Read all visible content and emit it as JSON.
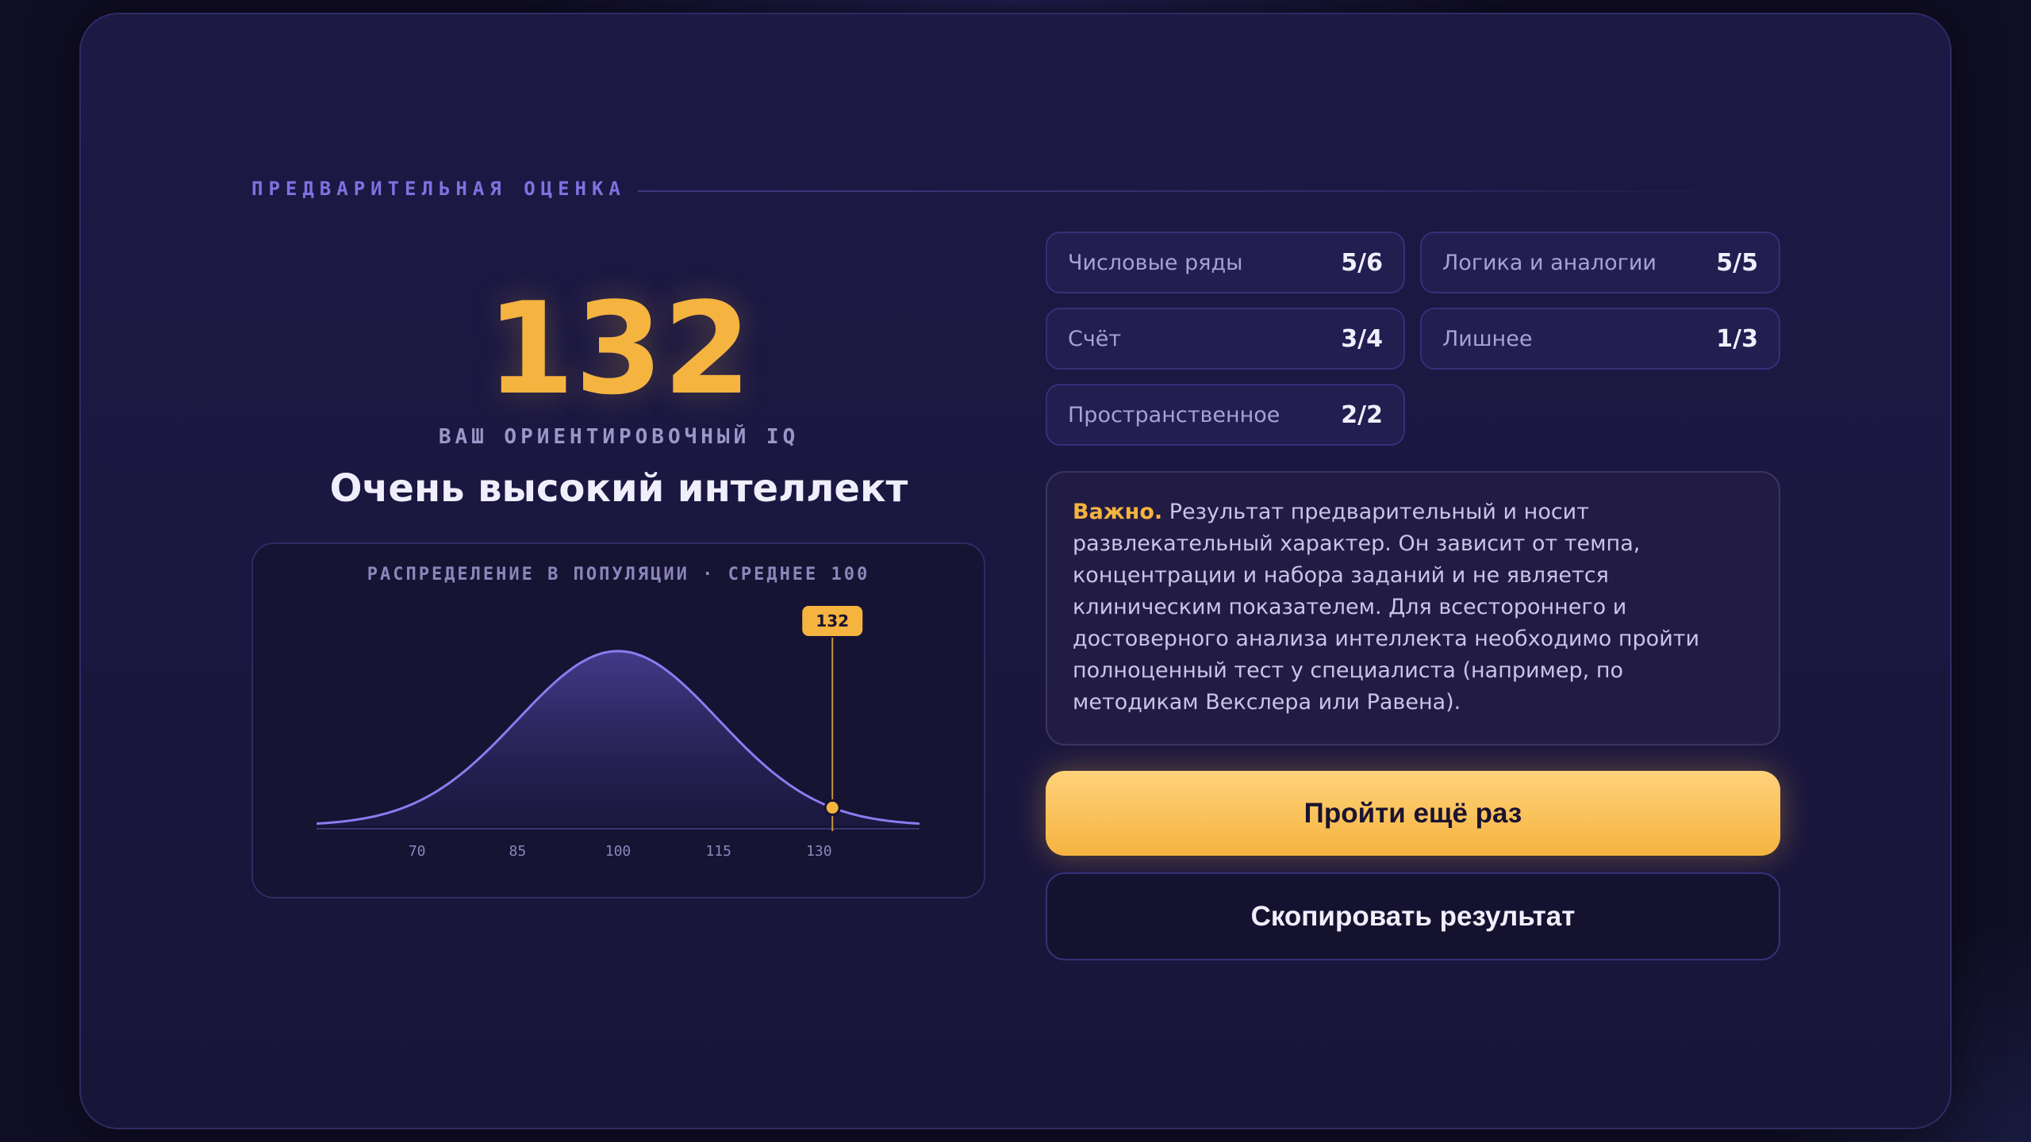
{
  "eyebrow": "ПРЕДВАРИТЕЛЬНАЯ ОЦЕНКА",
  "score": {
    "value": "132",
    "label": "ВАШ ОРИЕНТИРОВОЧНЫЙ IQ",
    "verdict": "Очень высокий интеллект"
  },
  "distribution": {
    "title": "РАСПРЕДЕЛЕНИЕ В ПОПУЛЯЦИИ · СРЕДНЕЕ 100",
    "marker_label": "132"
  },
  "chart_data": {
    "type": "area",
    "title": "РАСПРЕДЕЛЕНИЕ В ПОПУЛЯЦИИ · СРЕДНЕЕ 100",
    "distribution": "normal",
    "mean": 100,
    "sd": 15,
    "xlim": [
      55,
      145
    ],
    "x_ticks": [
      70,
      85,
      100,
      115,
      130
    ],
    "marker": {
      "x": 132,
      "label": "132"
    },
    "colors": {
      "curve": "#8b7cf0",
      "marker": "#f5b340"
    }
  },
  "stats": [
    {
      "name": "Числовые ряды",
      "value": "5/6"
    },
    {
      "name": "Логика и аналогии",
      "value": "5/5"
    },
    {
      "name": "Счёт",
      "value": "3/4"
    },
    {
      "name": "Лишнее",
      "value": "1/3"
    },
    {
      "name": "Пространственное",
      "value": "2/2"
    }
  ],
  "note": {
    "strong": "Важно.",
    "text": " Результат предварительный и носит развлекательный характер. Он зависит от темпа, концентрации и набора заданий и не является клиническим показателем. Для всестороннего и достоверного анализа интеллекта необходимо пройти полноценный тест у специалиста (например, по методикам Векслера или Равена)."
  },
  "buttons": {
    "retry": "Пройти ещё раз",
    "copy": "Скопировать результат"
  },
  "colors": {
    "accent": "#f5b340",
    "purple": "#8b7cf0",
    "background": "#1c1945"
  }
}
